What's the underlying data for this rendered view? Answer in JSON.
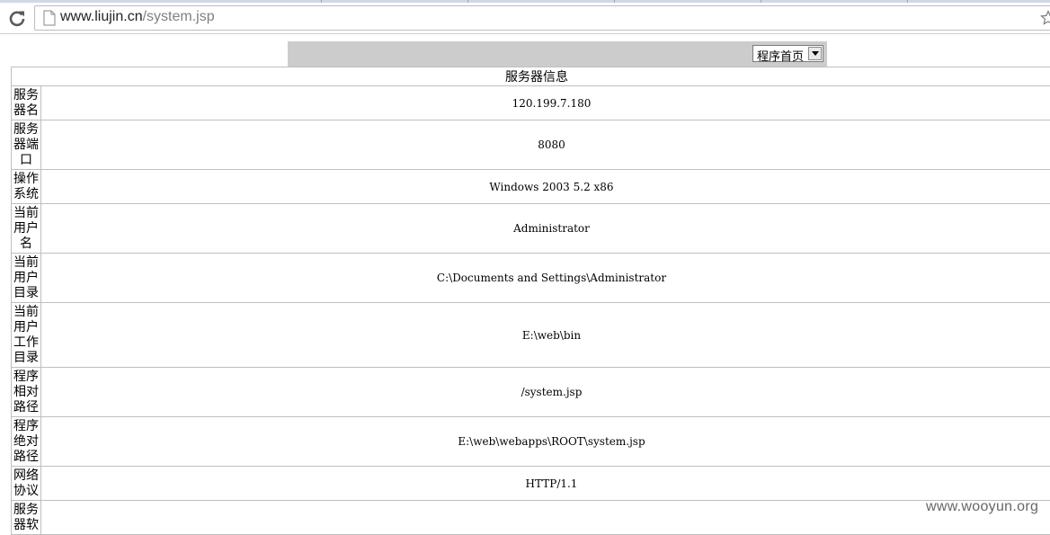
{
  "browser": {
    "url_host": "www.liujin.cn",
    "url_path": "/system.jsp"
  },
  "nav": {
    "selected": "程序首页"
  },
  "table": {
    "header": "服务器信息",
    "rows": [
      {
        "label": "服务器名",
        "value": "120.199.7.180"
      },
      {
        "label": "服务器端口",
        "value": "8080"
      },
      {
        "label": "操作系统",
        "value": "Windows 2003 5.2 x86"
      },
      {
        "label": "当前用户名",
        "value": "Administrator"
      },
      {
        "label": "当前用户目录",
        "value": "C:\\Documents and Settings\\Administrator"
      },
      {
        "label": "当前用户工作目录",
        "value": "E:\\web\\bin"
      },
      {
        "label": "程序相对路径",
        "value": "/system.jsp"
      },
      {
        "label": "程序绝对路径",
        "value": "E:\\web\\webapps\\ROOT\\system.jsp"
      },
      {
        "label": "网络协议",
        "value": "HTTP/1.1"
      },
      {
        "label": "服务器软",
        "value": ""
      }
    ]
  },
  "watermark": "www.wooyun.org"
}
